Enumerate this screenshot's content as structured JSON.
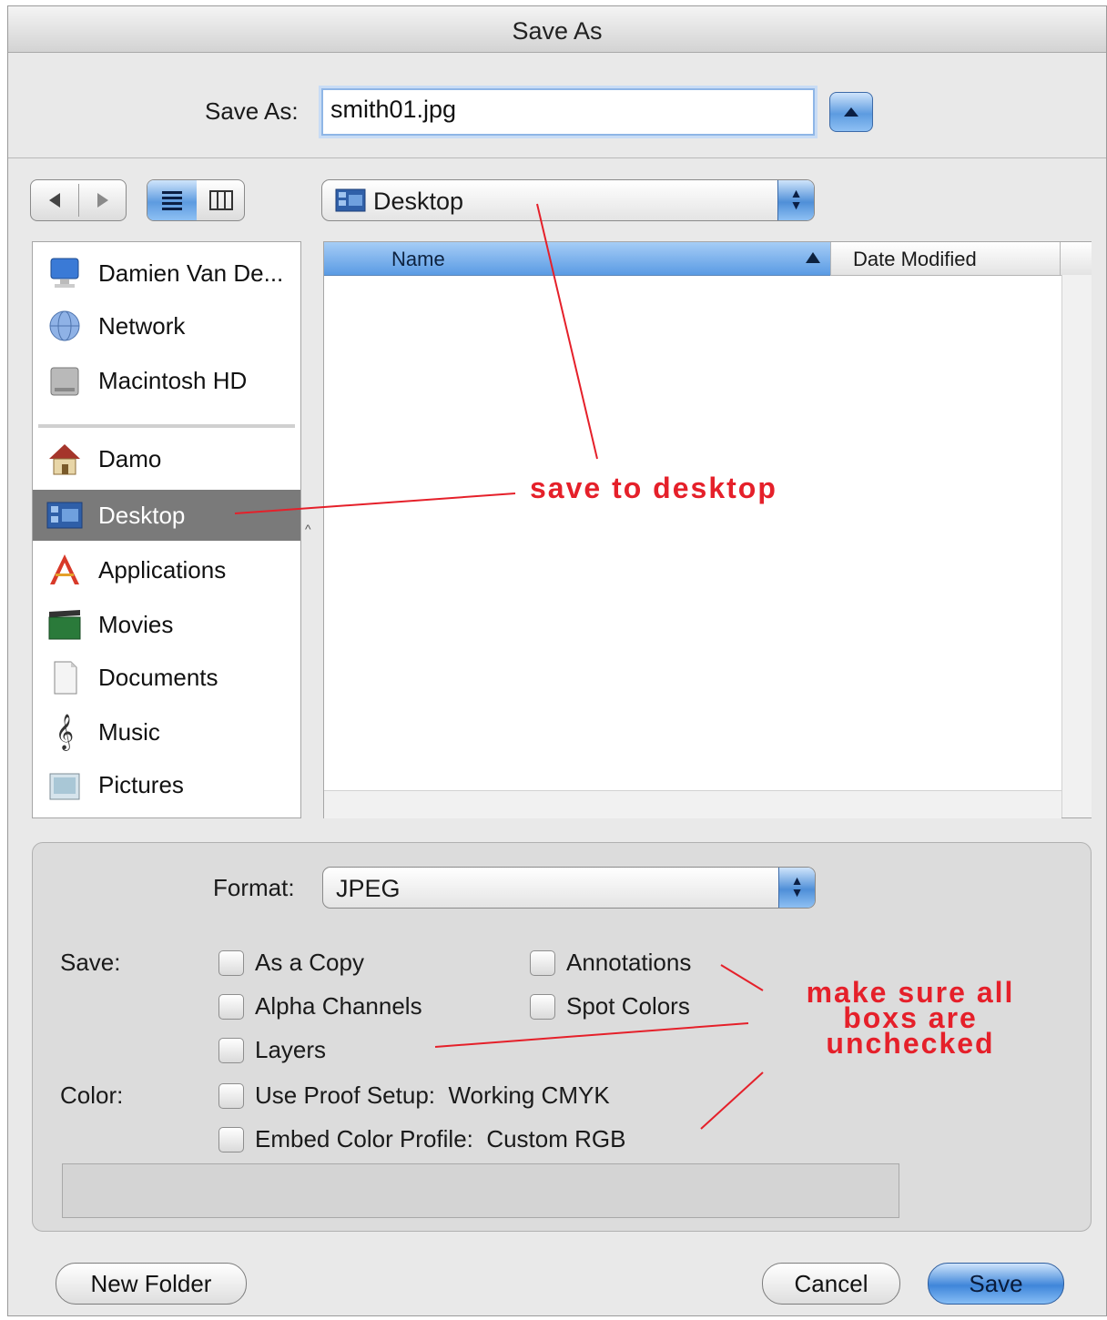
{
  "window": {
    "title": "Save As"
  },
  "save_as": {
    "label": "Save As:",
    "filename": "smith01.jpg"
  },
  "location": {
    "current": "Desktop"
  },
  "sidebar": {
    "devices": [
      {
        "label": "Damien Van De...",
        "icon": "computer-icon"
      },
      {
        "label": "Network",
        "icon": "network-globe-icon"
      },
      {
        "label": "Macintosh HD",
        "icon": "hard-drive-icon"
      }
    ],
    "places": [
      {
        "label": "Damo",
        "icon": "home-icon"
      },
      {
        "label": "Desktop",
        "icon": "desktop-folder-icon",
        "selected": true
      },
      {
        "label": "Applications",
        "icon": "applications-icon"
      },
      {
        "label": "Movies",
        "icon": "movies-icon"
      },
      {
        "label": "Documents",
        "icon": "documents-icon"
      },
      {
        "label": "Music",
        "icon": "music-icon"
      },
      {
        "label": "Pictures",
        "icon": "pictures-icon"
      }
    ]
  },
  "file_list": {
    "columns": [
      "Name",
      "Date Modified"
    ],
    "sort_column": "Name"
  },
  "options": {
    "format_label": "Format:",
    "format_value": "JPEG",
    "save_label": "Save:",
    "save_checkboxes": {
      "as_a_copy": {
        "label": "As a Copy",
        "checked": false
      },
      "annotations": {
        "label": "Annotations",
        "checked": false
      },
      "alpha_channels": {
        "label": "Alpha Channels",
        "checked": false
      },
      "spot_colors": {
        "label": "Spot Colors",
        "checked": false
      },
      "layers": {
        "label": "Layers",
        "checked": false
      }
    },
    "color_label": "Color:",
    "color_checkboxes": {
      "use_proof_setup": {
        "label": "Use Proof Setup:  Working CMYK",
        "checked": false
      },
      "embed_color_profile": {
        "label": "Embed Color Profile:  Custom RGB",
        "checked": false
      }
    }
  },
  "buttons": {
    "new_folder": "New Folder",
    "cancel": "Cancel",
    "save": "Save"
  },
  "annotations": {
    "desktop_note": "save to desktop",
    "checkbox_note_line1": "make sure all",
    "checkbox_note_line2": "boxs are",
    "checkbox_note_line3": "unchecked",
    "color": "#e5202a"
  }
}
